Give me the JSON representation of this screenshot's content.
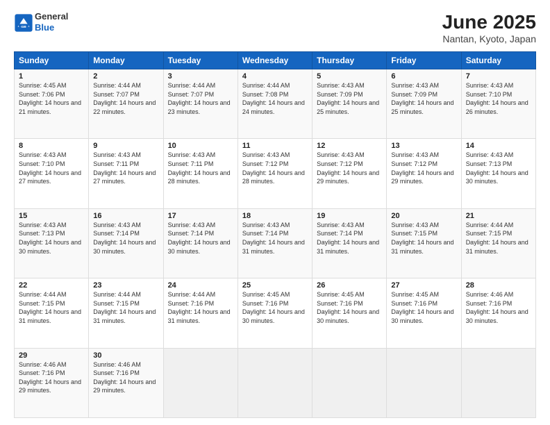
{
  "header": {
    "logo_line1": "General",
    "logo_line2": "Blue",
    "title": "June 2025",
    "subtitle": "Nantan, Kyoto, Japan"
  },
  "weekdays": [
    "Sunday",
    "Monday",
    "Tuesday",
    "Wednesday",
    "Thursday",
    "Friday",
    "Saturday"
  ],
  "weeks": [
    [
      {
        "day": "1",
        "sunrise": "4:45 AM",
        "sunset": "7:06 PM",
        "daylight": "14 hours and 21 minutes."
      },
      {
        "day": "2",
        "sunrise": "4:44 AM",
        "sunset": "7:07 PM",
        "daylight": "14 hours and 22 minutes."
      },
      {
        "day": "3",
        "sunrise": "4:44 AM",
        "sunset": "7:07 PM",
        "daylight": "14 hours and 23 minutes."
      },
      {
        "day": "4",
        "sunrise": "4:44 AM",
        "sunset": "7:08 PM",
        "daylight": "14 hours and 24 minutes."
      },
      {
        "day": "5",
        "sunrise": "4:43 AM",
        "sunset": "7:09 PM",
        "daylight": "14 hours and 25 minutes."
      },
      {
        "day": "6",
        "sunrise": "4:43 AM",
        "sunset": "7:09 PM",
        "daylight": "14 hours and 25 minutes."
      },
      {
        "day": "7",
        "sunrise": "4:43 AM",
        "sunset": "7:10 PM",
        "daylight": "14 hours and 26 minutes."
      }
    ],
    [
      {
        "day": "8",
        "sunrise": "4:43 AM",
        "sunset": "7:10 PM",
        "daylight": "14 hours and 27 minutes."
      },
      {
        "day": "9",
        "sunrise": "4:43 AM",
        "sunset": "7:11 PM",
        "daylight": "14 hours and 27 minutes."
      },
      {
        "day": "10",
        "sunrise": "4:43 AM",
        "sunset": "7:11 PM",
        "daylight": "14 hours and 28 minutes."
      },
      {
        "day": "11",
        "sunrise": "4:43 AM",
        "sunset": "7:12 PM",
        "daylight": "14 hours and 28 minutes."
      },
      {
        "day": "12",
        "sunrise": "4:43 AM",
        "sunset": "7:12 PM",
        "daylight": "14 hours and 29 minutes."
      },
      {
        "day": "13",
        "sunrise": "4:43 AM",
        "sunset": "7:12 PM",
        "daylight": "14 hours and 29 minutes."
      },
      {
        "day": "14",
        "sunrise": "4:43 AM",
        "sunset": "7:13 PM",
        "daylight": "14 hours and 30 minutes."
      }
    ],
    [
      {
        "day": "15",
        "sunrise": "4:43 AM",
        "sunset": "7:13 PM",
        "daylight": "14 hours and 30 minutes."
      },
      {
        "day": "16",
        "sunrise": "4:43 AM",
        "sunset": "7:14 PM",
        "daylight": "14 hours and 30 minutes."
      },
      {
        "day": "17",
        "sunrise": "4:43 AM",
        "sunset": "7:14 PM",
        "daylight": "14 hours and 30 minutes."
      },
      {
        "day": "18",
        "sunrise": "4:43 AM",
        "sunset": "7:14 PM",
        "daylight": "14 hours and 31 minutes."
      },
      {
        "day": "19",
        "sunrise": "4:43 AM",
        "sunset": "7:14 PM",
        "daylight": "14 hours and 31 minutes."
      },
      {
        "day": "20",
        "sunrise": "4:43 AM",
        "sunset": "7:15 PM",
        "daylight": "14 hours and 31 minutes."
      },
      {
        "day": "21",
        "sunrise": "4:44 AM",
        "sunset": "7:15 PM",
        "daylight": "14 hours and 31 minutes."
      }
    ],
    [
      {
        "day": "22",
        "sunrise": "4:44 AM",
        "sunset": "7:15 PM",
        "daylight": "14 hours and 31 minutes."
      },
      {
        "day": "23",
        "sunrise": "4:44 AM",
        "sunset": "7:15 PM",
        "daylight": "14 hours and 31 minutes."
      },
      {
        "day": "24",
        "sunrise": "4:44 AM",
        "sunset": "7:16 PM",
        "daylight": "14 hours and 31 minutes."
      },
      {
        "day": "25",
        "sunrise": "4:45 AM",
        "sunset": "7:16 PM",
        "daylight": "14 hours and 30 minutes."
      },
      {
        "day": "26",
        "sunrise": "4:45 AM",
        "sunset": "7:16 PM",
        "daylight": "14 hours and 30 minutes."
      },
      {
        "day": "27",
        "sunrise": "4:45 AM",
        "sunset": "7:16 PM",
        "daylight": "14 hours and 30 minutes."
      },
      {
        "day": "28",
        "sunrise": "4:46 AM",
        "sunset": "7:16 PM",
        "daylight": "14 hours and 30 minutes."
      }
    ],
    [
      {
        "day": "29",
        "sunrise": "4:46 AM",
        "sunset": "7:16 PM",
        "daylight": "14 hours and 29 minutes."
      },
      {
        "day": "30",
        "sunrise": "4:46 AM",
        "sunset": "7:16 PM",
        "daylight": "14 hours and 29 minutes."
      },
      null,
      null,
      null,
      null,
      null
    ]
  ]
}
